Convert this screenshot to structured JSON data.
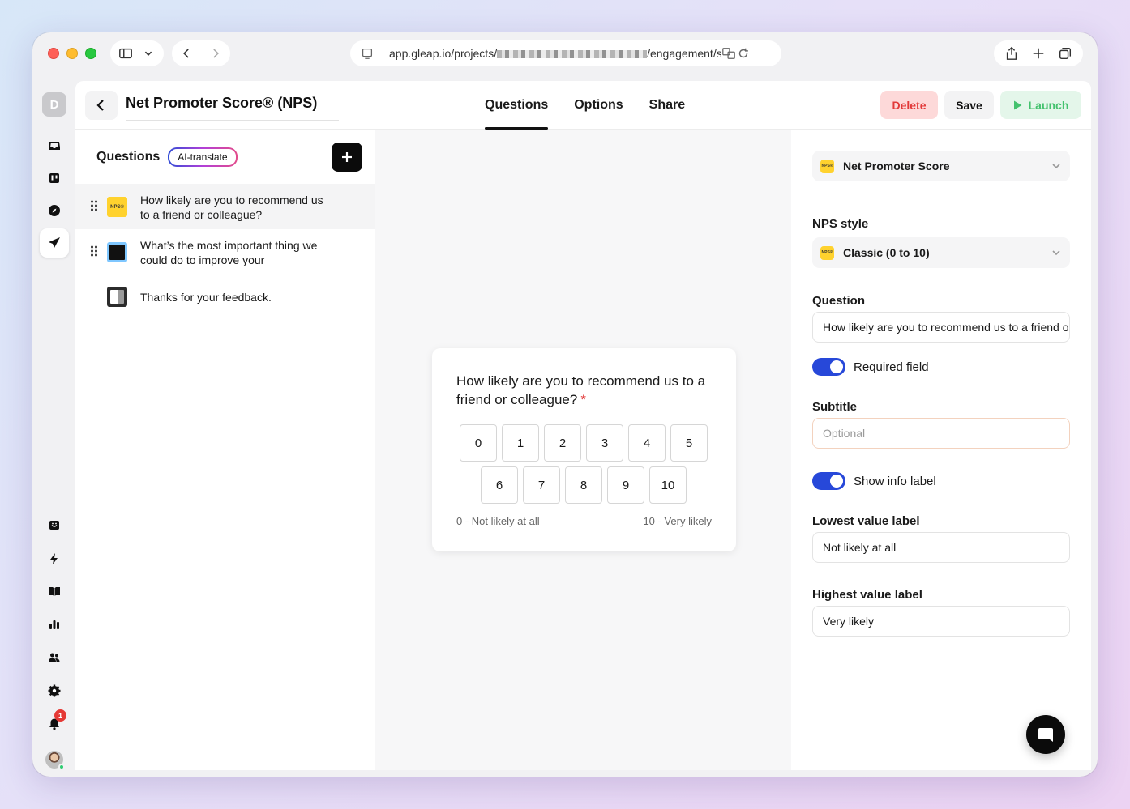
{
  "browser": {
    "url_prefix": "app.gleap.io/projects/",
    "url_suffix": "/engagement/surv"
  },
  "rail": {
    "workspace_initial": "D",
    "notification_count": "1"
  },
  "header": {
    "title": "Net Promoter Score® (NPS)",
    "tabs": [
      "Questions",
      "Options",
      "Share"
    ],
    "active_tab": "Questions",
    "delete_label": "Delete",
    "save_label": "Save",
    "launch_label": "Launch"
  },
  "questions_panel": {
    "title": "Questions",
    "ai_translate_label": "AI-translate",
    "items": [
      {
        "icon": "nps-icon",
        "icon_text": "NPS®",
        "text": "How likely are you to recommend us to a friend or colleague?"
      },
      {
        "icon": "text-input-icon",
        "text": "What’s the most important thing we could do to improve your"
      },
      {
        "icon": "end-screen-icon",
        "text": "Thanks for your feedback."
      }
    ]
  },
  "preview": {
    "question": "How likely are you to recommend us to a friend or colleague?",
    "required_mark": "*",
    "scale_row1": [
      "0",
      "1",
      "2",
      "3",
      "4",
      "5"
    ],
    "scale_row2": [
      "6",
      "7",
      "8",
      "9",
      "10"
    ],
    "lowest_label": "0 - Not likely at all",
    "highest_label": "10 - Very likely"
  },
  "settings": {
    "type_select": "Net Promoter Score",
    "type_chip": "NPS®",
    "nps_style_label": "NPS style",
    "nps_style_value": "Classic (0 to 10)",
    "question_label": "Question",
    "question_value": "How likely are you to recommend us to a friend or colleague?",
    "required_label": "Required field",
    "required_on": true,
    "subtitle_label": "Subtitle",
    "subtitle_placeholder": "Optional",
    "show_info_label": "Show info label",
    "show_info_on": true,
    "lowest_label_title": "Lowest value label",
    "lowest_label_value": "Not likely at all",
    "highest_label_title": "Highest value label",
    "highest_label_value": "Very likely"
  },
  "colors": {
    "accent": "#2748d9",
    "danger": "#e23b3b",
    "success": "#44c26e",
    "nps_yellow": "#ffd22e"
  }
}
